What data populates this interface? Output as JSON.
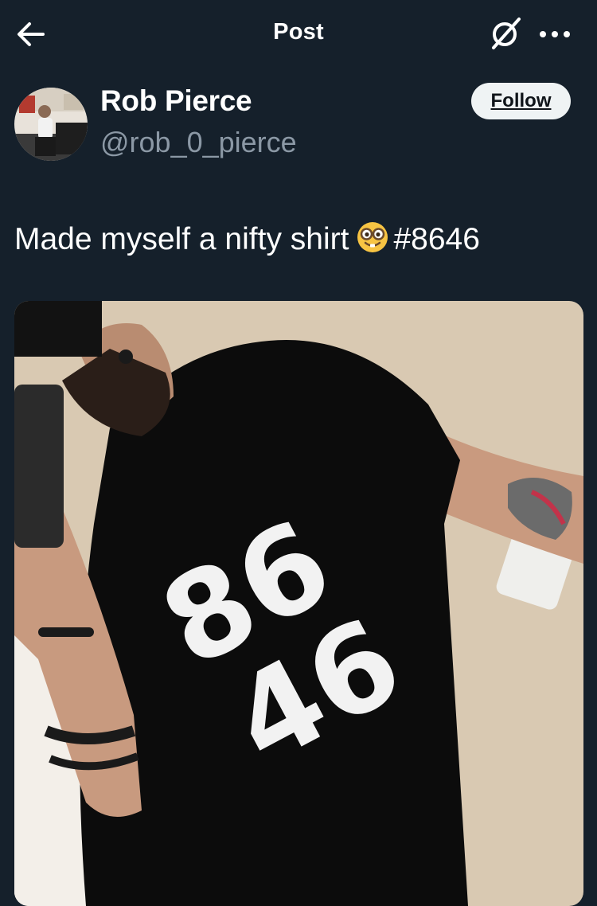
{
  "header": {
    "title": "Post",
    "back_icon": "arrow-left-icon",
    "grok_icon": "grok-icon",
    "more_icon": "more-horizontal-icon"
  },
  "author": {
    "name": "Rob Pierce",
    "handle": "@rob_0_pierce",
    "follow_label": "Follow"
  },
  "post": {
    "text": "Made myself a nifty shirt",
    "emoji": "nerd-face",
    "hashtag": "#8646"
  },
  "media": {
    "shirt_text_line1": "86",
    "shirt_text_line2": "46",
    "description_icon": "photo"
  },
  "colors": {
    "background": "#15202b",
    "text_primary": "#ffffff",
    "text_secondary": "#8b98a5",
    "follow_bg": "#eff3f4",
    "follow_text": "#0f1419"
  }
}
